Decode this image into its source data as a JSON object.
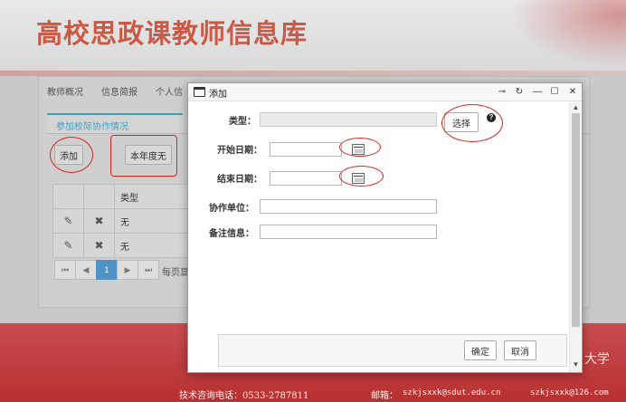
{
  "app": {
    "title": "高校思政课教师信息库"
  },
  "nav": {
    "items": [
      "教师概况",
      "信息简报",
      "个人信"
    ]
  },
  "subtab": {
    "label": "参加校际协作情况"
  },
  "toolbar": {
    "add_label": "添加",
    "year_label": "本年度无"
  },
  "table": {
    "header_type": "类型",
    "rows": [
      {
        "type": "无"
      },
      {
        "type": "无"
      }
    ]
  },
  "pagination": {
    "first": "⏮",
    "prev": "◀",
    "page": "1",
    "next": "▶",
    "last": "⏭",
    "per_page_label": "每页显"
  },
  "modal": {
    "title": "添加",
    "controls": {
      "pin": "⊸",
      "refresh": "↻",
      "minimize": "—",
      "maximize": "☐",
      "close": "✕"
    },
    "fields": {
      "type_label": "类型：",
      "choose_label": "选择",
      "help": "?",
      "start_label": "开始日期：",
      "end_label": "结束日期：",
      "org_label": "协作单位：",
      "note_label": "备注信息："
    },
    "confirm_label": "确定",
    "cancel_label": "取消"
  },
  "footer": {
    "university_fragment": "大学",
    "contact": "技术咨询电话：0533-2787811",
    "mail_label": "邮箱：",
    "email1": "szkjsxxk@sdut.edu.cn",
    "email2": "szkjsxxk@126.com"
  },
  "colors": {
    "accent": "#d8261c",
    "title_red": "#c85a46",
    "teal": "#35a3b8",
    "pager_blue": "#4f93c7"
  }
}
